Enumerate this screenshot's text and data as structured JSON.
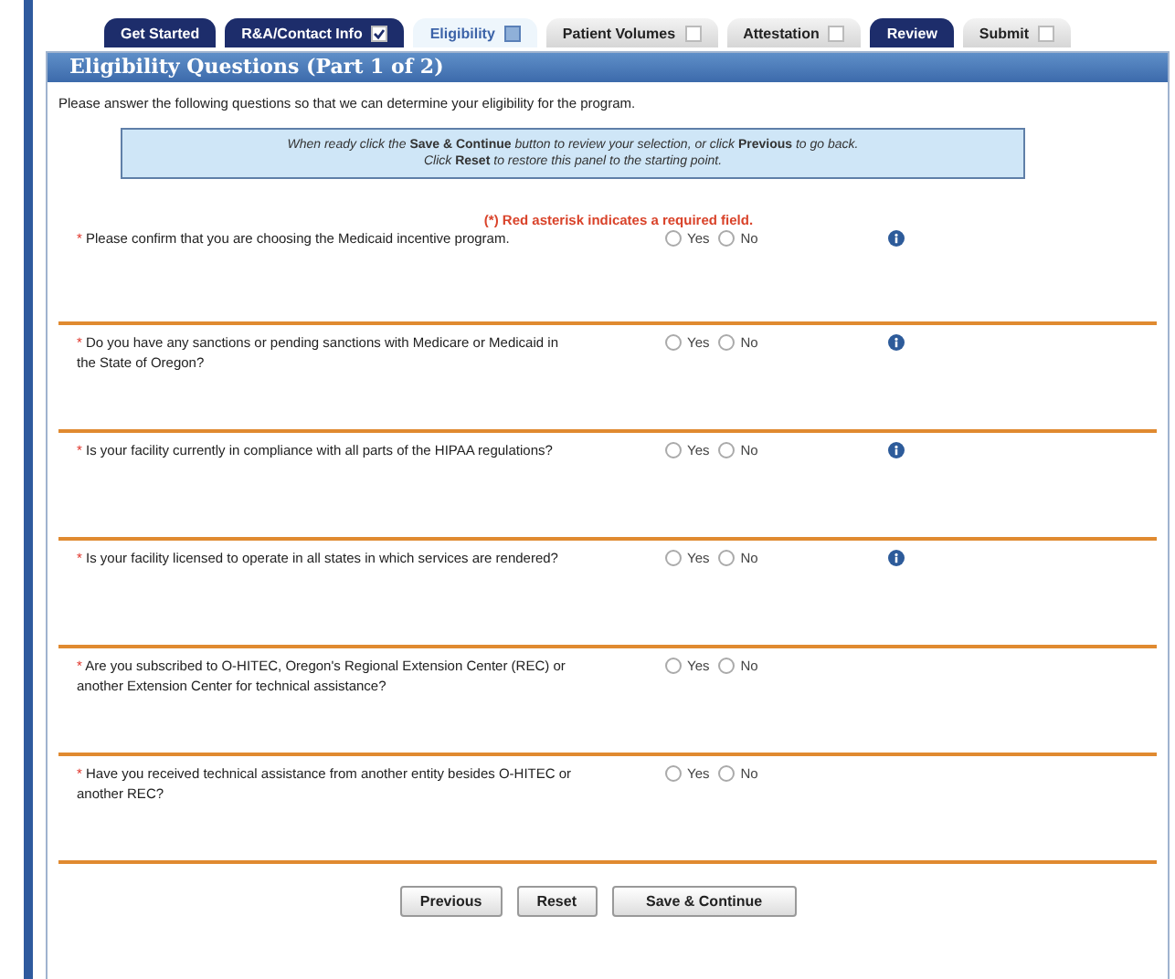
{
  "tabs": [
    {
      "label": "Get Started",
      "kind": "plain",
      "disabled": false,
      "selected": false
    },
    {
      "label": "R&A/Contact Info",
      "kind": "box",
      "checked": true,
      "disabled": false,
      "selected": false
    },
    {
      "label": "Eligibility",
      "kind": "box",
      "checked": false,
      "disabled": false,
      "selected": true
    },
    {
      "label": "Patient Volumes",
      "kind": "box",
      "checked": false,
      "disabled": true,
      "selected": false
    },
    {
      "label": "Attestation",
      "kind": "box",
      "checked": false,
      "disabled": true,
      "selected": false
    },
    {
      "label": "Review",
      "kind": "plain",
      "disabled": false,
      "selected": false
    },
    {
      "label": "Submit",
      "kind": "box",
      "checked": false,
      "disabled": true,
      "selected": false
    }
  ],
  "panel": {
    "title": "Eligibility Questions (Part 1 of 2)",
    "intro": "Please answer the following questions so that we can determine your eligibility for the program.",
    "note": [
      "*When ready click the* **Save & Continue** *button to review your selection, or click* **Previous** *to go back.*",
      "*Click* **Reset** *to restore this panel to the starting point.*"
    ],
    "required_note": "(*) Red asterisk indicates a required field.",
    "questions": [
      {
        "asterisk": "*",
        "text": "Please confirm that you are choosing the Medicaid incentive program.",
        "help": true,
        "options": [
          {
            "label": "Yes",
            "selected": false
          },
          {
            "label": "No",
            "selected": false
          }
        ]
      },
      {
        "asterisk": "*",
        "text": "Do you have any sanctions or pending sanctions with Medicare or Medicaid in the State of Oregon?",
        "help": true,
        "options": [
          {
            "label": "Yes",
            "selected": false
          },
          {
            "label": "No",
            "selected": false
          }
        ]
      },
      {
        "asterisk": "*",
        "text": "Is your facility currently in compliance with all parts of the HIPAA regulations?",
        "help": true,
        "options": [
          {
            "label": "Yes",
            "selected": false
          },
          {
            "label": "No",
            "selected": false
          }
        ]
      },
      {
        "asterisk": "*",
        "text": "Is your facility licensed to operate in all states in which services are rendered?",
        "help": true,
        "options": [
          {
            "label": "Yes",
            "selected": false
          },
          {
            "label": "No",
            "selected": false
          }
        ]
      },
      {
        "asterisk": "*",
        "text": "Are you subscribed to O-HITEC, Oregon's Regional Extension Center (REC) or another Extension Center for technical assistance?",
        "help": false,
        "options": [
          {
            "label": "Yes",
            "selected": false
          },
          {
            "label": "No",
            "selected": false
          }
        ]
      },
      {
        "asterisk": "*",
        "text": "Have you received technical assistance from another entity besides O-HITEC or another REC?",
        "help": false,
        "options": [
          {
            "label": "Yes",
            "selected": false
          },
          {
            "label": "No",
            "selected": false
          }
        ]
      }
    ],
    "buttons": [
      "Previous",
      "Reset",
      "Save & Continue"
    ]
  }
}
